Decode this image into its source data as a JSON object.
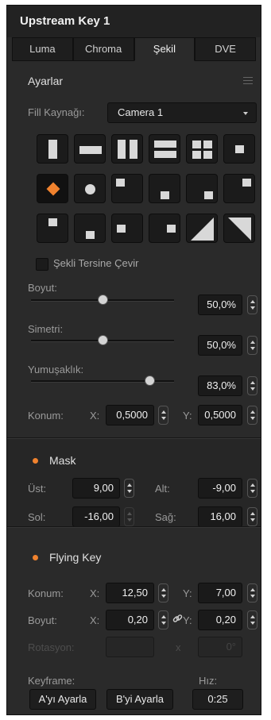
{
  "panel": {
    "title": "Upstream Key 1"
  },
  "tabs": [
    {
      "label": "Luma",
      "active": false
    },
    {
      "label": "Chroma",
      "active": false
    },
    {
      "label": "Şekil",
      "active": true
    },
    {
      "label": "DVE",
      "active": false
    }
  ],
  "settings": {
    "header": "Ayarlar",
    "fill_source_label": "Fill Kaynağı:",
    "fill_source_value": "Camera 1",
    "pattern_icons": [
      "vertical-bar-pattern-icon",
      "horizontal-bar-pattern-icon",
      "vertical-split-pattern-icon",
      "horizontal-split-pattern-icon",
      "four-box-pattern-icon",
      "center-box-pattern-icon",
      "diamond-pattern-icon",
      "circle-pattern-icon",
      "box-top-left-pattern-icon",
      "box-top-center-pattern-icon",
      "box-top-right-pattern-icon",
      "box-right-center-pattern-icon",
      "box-bottom-left-pattern-icon",
      "box-bottom-center-pattern-icon",
      "box-middle-left-pattern-icon",
      "box-middle-right-pattern-icon",
      "diagonal-top-left-pattern-icon",
      "diagonal-top-right-pattern-icon"
    ],
    "selected_pattern": "diamond-pattern-icon",
    "invert_label": "Şekli Tersine Çevir",
    "invert_checked": false,
    "size_label": "Boyut:",
    "size_value": "50,0%",
    "size_level": 0.5,
    "symmetry_label": "Simetri:",
    "symmetry_value": "50,0%",
    "symmetry_level": 0.5,
    "softness_label": "Yumuşaklık:",
    "softness_value": "83,0%",
    "softness_level": 0.83,
    "position_label": "Konum:",
    "x_label": "X:",
    "x_value": "0,5000",
    "y_label": "Y:",
    "y_value": "0,5000"
  },
  "mask": {
    "title": "Mask",
    "enabled": true,
    "top_label": "Üst:",
    "top_value": "9,00",
    "bottom_label": "Alt:",
    "bottom_value": "-9,00",
    "left_label": "Sol:",
    "left_value": "-16,00",
    "right_label": "Sağ:",
    "right_value": "16,00"
  },
  "flying_key": {
    "title": "Flying Key",
    "enabled": true,
    "position_label": "Konum:",
    "pos_x_label": "X:",
    "pos_x_value": "12,50",
    "pos_y_label": "Y:",
    "pos_y_value": "7,00",
    "size_label": "Boyut:",
    "size_x_label": "X:",
    "size_x_value": "0,20",
    "size_y_label": "Y:",
    "size_y_value": "0,20",
    "rotation_label": "Rotasyon:",
    "rotation_x_label": "x",
    "rotation_value": "0°",
    "keyframe_label": "Keyframe:",
    "set_a_label": "A'yı Ayarla",
    "set_b_label": "B'yi Ayarla",
    "rate_label": "Hız:",
    "rate_value": "0:25"
  },
  "colors": {
    "accent": "#f0822e",
    "panel": "#2a2a2a",
    "field": "#1a1a1a"
  }
}
